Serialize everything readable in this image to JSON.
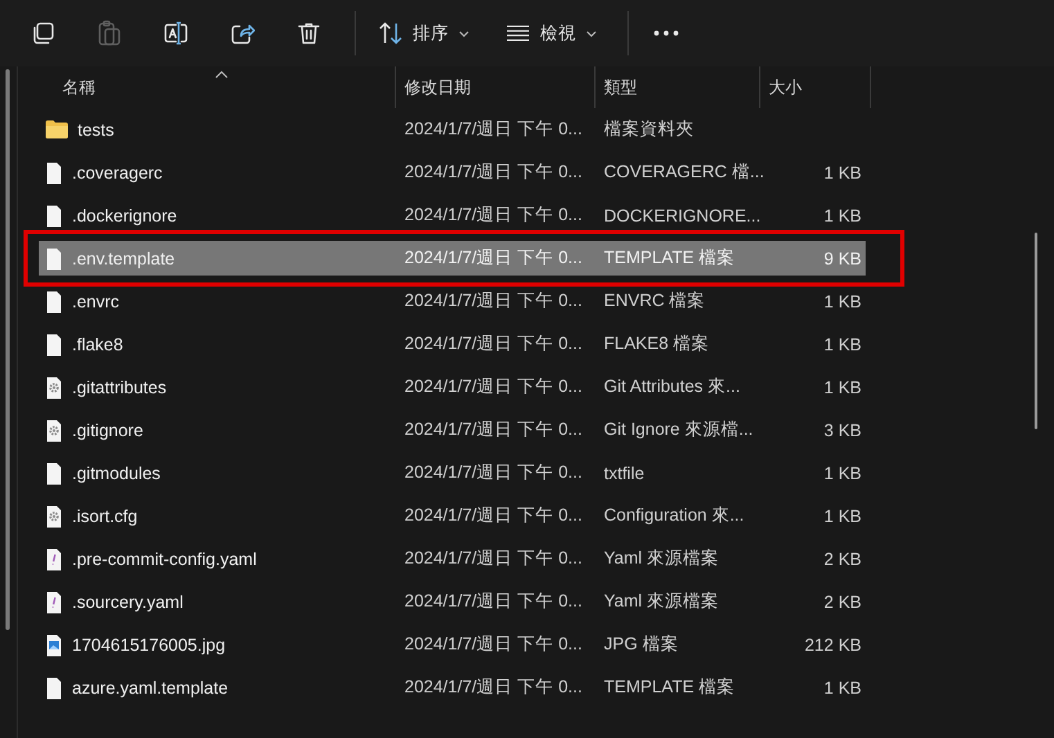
{
  "toolbar": {
    "buttons": [
      {
        "kind": "copy",
        "disabled": false
      },
      {
        "kind": "paste",
        "disabled": true
      },
      {
        "kind": "rename",
        "disabled": false
      },
      {
        "kind": "share",
        "disabled": false
      },
      {
        "kind": "delete",
        "disabled": false
      }
    ],
    "sort": {
      "label": "排序"
    },
    "view": {
      "label": "檢視"
    }
  },
  "columns": [
    {
      "label": "名稱",
      "sorted": true
    },
    {
      "label": "修改日期",
      "sorted": false
    },
    {
      "label": "類型",
      "sorted": false
    },
    {
      "label": "大小",
      "sorted": false
    }
  ],
  "rows": [
    {
      "kind": "folder",
      "name": "tests",
      "date": "2024/1/7/週日 下午 0...",
      "type": "檔案資料夾",
      "size": "",
      "selected": false,
      "outlined": false
    },
    {
      "kind": "file",
      "name": ".coveragerc",
      "date": "2024/1/7/週日 下午 0...",
      "type": "COVERAGERC 檔...",
      "size": "1 KB",
      "selected": false,
      "outlined": false
    },
    {
      "kind": "file",
      "name": ".dockerignore",
      "date": "2024/1/7/週日 下午 0...",
      "type": "DOCKERIGNORE...",
      "size": "1 KB",
      "selected": false,
      "outlined": false
    },
    {
      "kind": "file",
      "name": ".env.template",
      "date": "2024/1/7/週日 下午 0...",
      "type": "TEMPLATE 檔案",
      "size": "9 KB",
      "selected": true,
      "outlined": true
    },
    {
      "kind": "file",
      "name": ".envrc",
      "date": "2024/1/7/週日 下午 0...",
      "type": "ENVRC 檔案",
      "size": "1 KB",
      "selected": false,
      "outlined": false
    },
    {
      "kind": "file",
      "name": ".flake8",
      "date": "2024/1/7/週日 下午 0...",
      "type": "FLAKE8 檔案",
      "size": "1 KB",
      "selected": false,
      "outlined": false
    },
    {
      "kind": "config",
      "name": ".gitattributes",
      "date": "2024/1/7/週日 下午 0...",
      "type": "Git Attributes 來...",
      "size": "1 KB",
      "selected": false,
      "outlined": false
    },
    {
      "kind": "config",
      "name": ".gitignore",
      "date": "2024/1/7/週日 下午 0...",
      "type": "Git Ignore 來源檔...",
      "size": "3 KB",
      "selected": false,
      "outlined": false
    },
    {
      "kind": "file",
      "name": ".gitmodules",
      "date": "2024/1/7/週日 下午 0...",
      "type": "txtfile",
      "size": "1 KB",
      "selected": false,
      "outlined": false
    },
    {
      "kind": "config",
      "name": ".isort.cfg",
      "date": "2024/1/7/週日 下午 0...",
      "type": "Configuration 來...",
      "size": "1 KB",
      "selected": false,
      "outlined": false
    },
    {
      "kind": "yaml",
      "name": ".pre-commit-config.yaml",
      "date": "2024/1/7/週日 下午 0...",
      "type": "Yaml 來源檔案",
      "size": "2 KB",
      "selected": false,
      "outlined": false
    },
    {
      "kind": "yaml",
      "name": ".sourcery.yaml",
      "date": "2024/1/7/週日 下午 0...",
      "type": "Yaml 來源檔案",
      "size": "2 KB",
      "selected": false,
      "outlined": false
    },
    {
      "kind": "image",
      "name": "1704615176005.jpg",
      "date": "2024/1/7/週日 下午 0...",
      "type": "JPG 檔案",
      "size": "212 KB",
      "selected": false,
      "outlined": false
    },
    {
      "kind": "file",
      "name": "azure.yaml.template",
      "date": "2024/1/7/週日 下午 0...",
      "type": "TEMPLATE 檔案",
      "size": "1 KB",
      "selected": false,
      "outlined": false
    }
  ]
}
